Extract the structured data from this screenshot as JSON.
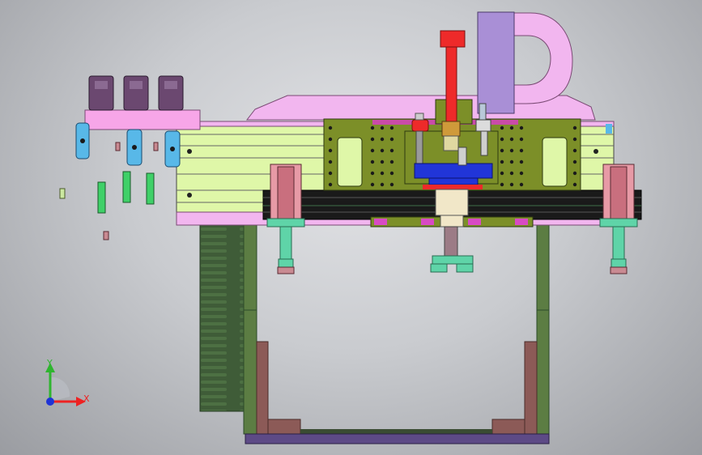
{
  "viewport": {
    "background_center": "#e2e3e6",
    "background_edge": "#9a9ca1"
  },
  "colors": {
    "pink": "#f7a6e8",
    "pink_light": "#f2b6ef",
    "olive": "#7c8f28",
    "light_green": "#dff7a8",
    "green_frame": "#5c7d43",
    "dark_frame": "#2c4a2a",
    "rail_black": "#1a1a1a",
    "purple": "#a98fd6",
    "purple_base": "#5d4a86",
    "red": "#ee2a2a",
    "blue": "#2135d8",
    "cyan": "#58b8e8",
    "teal": "#5fd4a8",
    "salmon_block": "#e79aa6",
    "rose": "#c98a92",
    "brown": "#8c5a57"
  },
  "triad": {
    "x_label": "X",
    "y_label": "Y",
    "x_color": "#ee2222",
    "y_color": "#2fb52f",
    "z_color": "#1f33d6"
  }
}
